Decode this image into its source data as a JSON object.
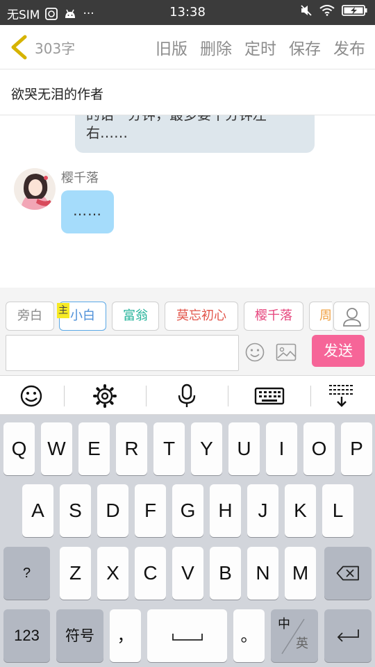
{
  "status_bar": {
    "carrier": "无SIM",
    "time": "13:38",
    "more": "···"
  },
  "header": {
    "word_count": "303字",
    "actions": [
      "旧版",
      "删除",
      "定时",
      "保存",
      "发布"
    ]
  },
  "story_title": "欲哭无泪的作者",
  "chat": {
    "previous_bubble_text": "的话一分钟，最多要十分钟左右……",
    "sender": "樱千落",
    "message": "……"
  },
  "characters": {
    "selected_badge": "主",
    "chips": [
      {
        "label": "旁白",
        "color": "#8a8a8a"
      },
      {
        "label": "小白",
        "color": "#4d8fd8"
      },
      {
        "label": "富翁",
        "color": "#23b39a"
      },
      {
        "label": "莫忘初心",
        "color": "#e2554a"
      },
      {
        "label": "樱千落",
        "color": "#e6457d"
      },
      {
        "label": "周",
        "color": "#f0a040"
      }
    ]
  },
  "input": {
    "placeholder": "",
    "send_label": "发送"
  },
  "keyboard": {
    "row1": [
      "Q",
      "W",
      "E",
      "R",
      "T",
      "Y",
      "U",
      "I",
      "O",
      "P"
    ],
    "row2": [
      "A",
      "S",
      "D",
      "F",
      "G",
      "H",
      "J",
      "K",
      "L"
    ],
    "row3": [
      "Z",
      "X",
      "C",
      "V",
      "B",
      "N",
      "M"
    ],
    "shift_label": "?",
    "num_label": "123",
    "symbol_label": "符号",
    "comma_label": "，",
    "period_label": "。",
    "lang_top": "中",
    "lang_bottom": "英"
  },
  "colors": {
    "send": "#f66598",
    "bubble": "#a5dcfb",
    "accent_back": "#d8b400"
  }
}
